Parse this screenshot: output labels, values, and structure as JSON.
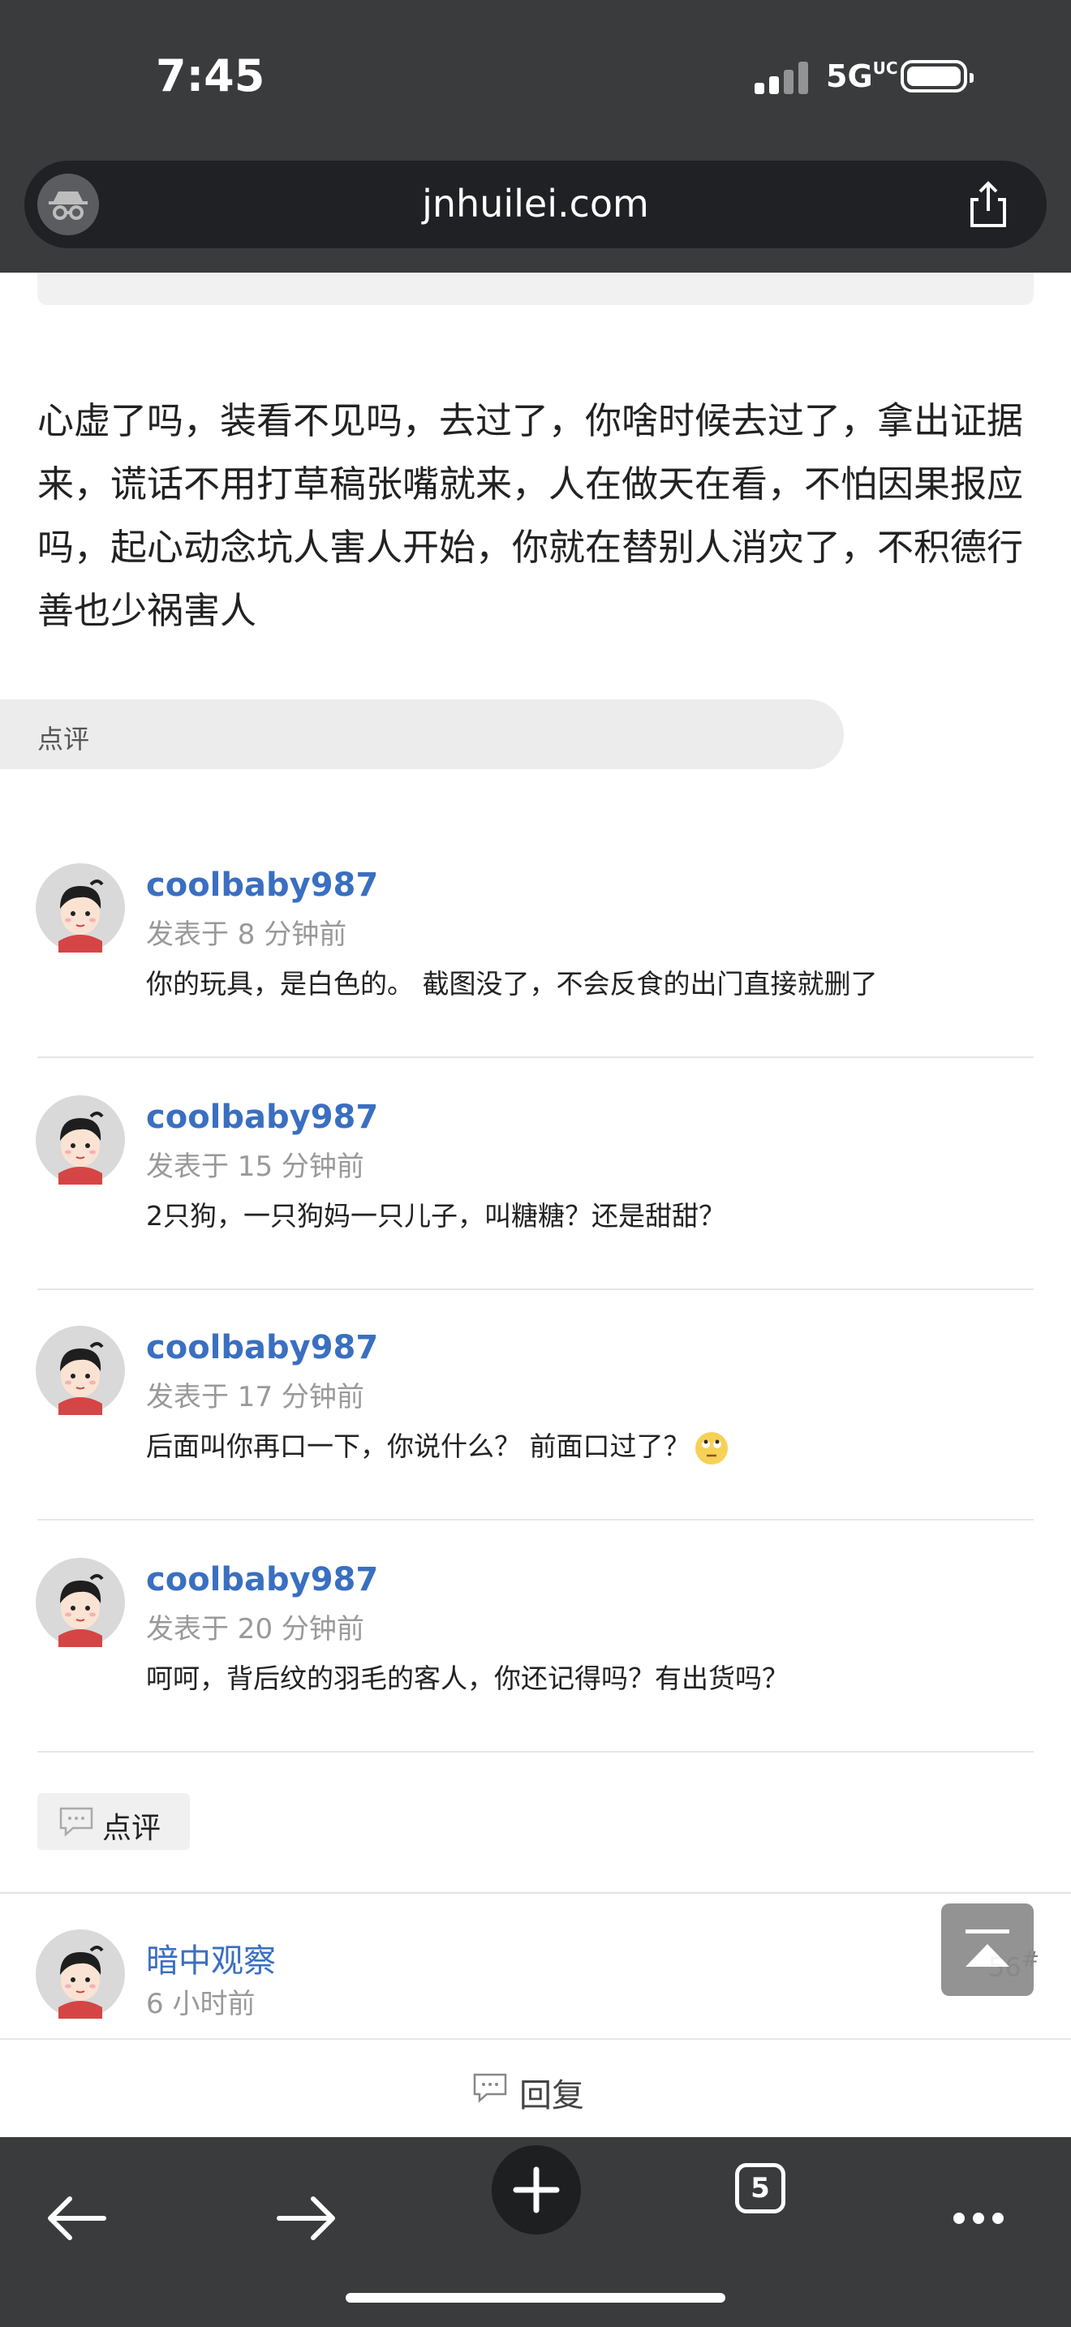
{
  "status_bar": {
    "time": "7:45",
    "network": "5G",
    "network_suffix": "UC"
  },
  "browser": {
    "url": "jnhuilei.com"
  },
  "post": {
    "text": "心虚了吗，装看不见吗，去过了，你啥时候去过了，拿出证据来，谎话不用打草稿张嘴就来，人在做天在看，不怕因果报应吗，起心动念坑人害人开始，你就在替别人消灾了，不积德行善也少祸害人"
  },
  "review_section": {
    "header": "点评",
    "button_label": "点评"
  },
  "comments": [
    {
      "user": "coolbaby987",
      "time": "发表于 8 分钟前",
      "text": "你的玩具，是白色的。 截图没了，不会反食的出门直接就删了"
    },
    {
      "user": "coolbaby987",
      "time": "发表于 15 分钟前",
      "text": "2只狗，一只狗妈一只儿子，叫糖糖？还是甜甜？"
    },
    {
      "user": "coolbaby987",
      "time": "发表于 17 分钟前",
      "text": "后面叫你再口一下，你说什么？ 前面口过了？",
      "emoji": "eye-roll-emoji"
    },
    {
      "user": "coolbaby987",
      "time": "发表于 20 分钟前",
      "text": "呵呵，背后纹的羽毛的客人，你还记得吗？有出货吗？"
    }
  ],
  "reply_post": {
    "user": "暗中观察",
    "time": "6 小时前",
    "floor": "56",
    "floor_suffix": "#"
  },
  "reply_bar": {
    "label": "回复"
  },
  "toolbar": {
    "tab_count": "5"
  },
  "colors": {
    "chrome": "#3a3b3d",
    "link": "#3a6fc1",
    "muted": "#999999"
  }
}
